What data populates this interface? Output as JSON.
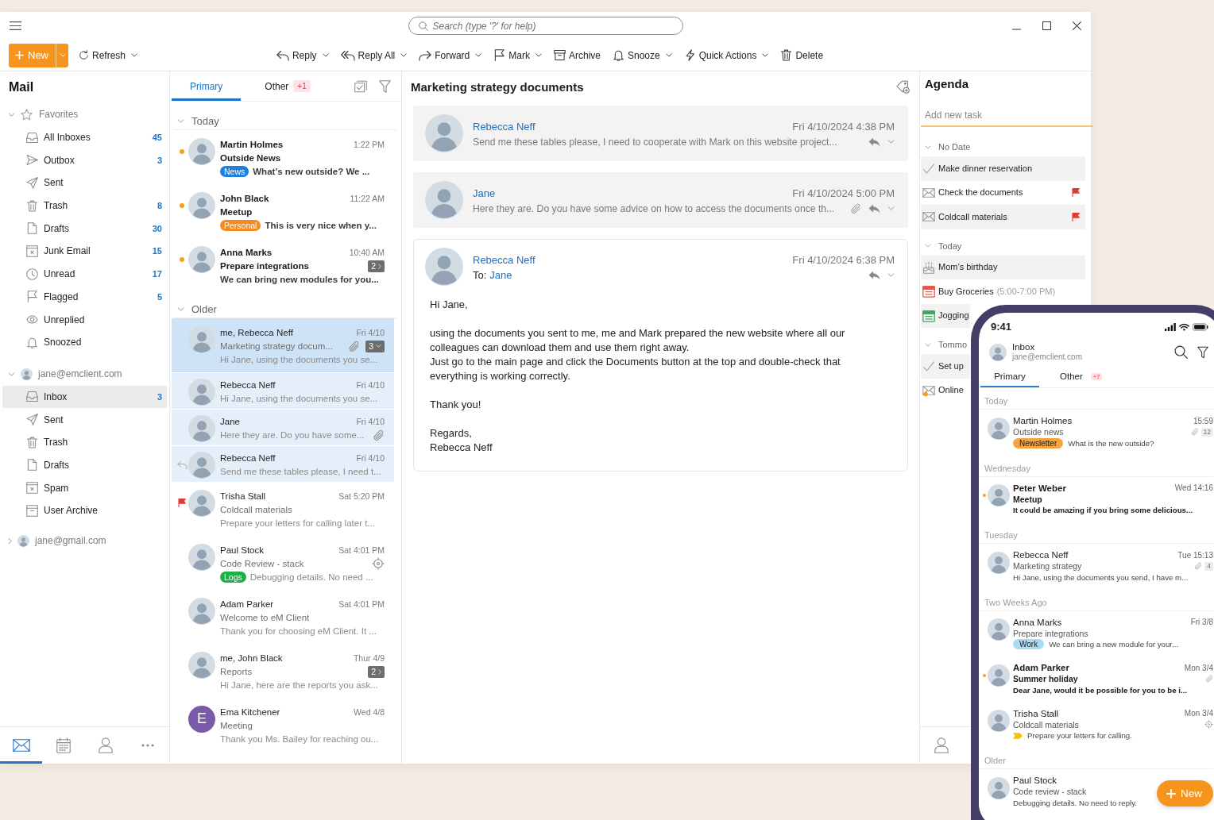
{
  "title_bar": {
    "search": {
      "placeholder": "Search (type '?' for help)"
    }
  },
  "toolbar": {
    "new_button": {
      "label": "New"
    },
    "refresh_button": {
      "label": "Refresh",
      "dropdown": true
    },
    "actions": [
      {
        "kind": "reply",
        "label": "Reply",
        "dropdown": true
      },
      {
        "kind": "replyall",
        "label": "Reply All",
        "dropdown": true
      },
      {
        "kind": "forward",
        "label": "Forward",
        "dropdown": true
      },
      {
        "kind": "mark",
        "label": "Mark",
        "dropdown": true
      },
      {
        "kind": "archive",
        "label": "Archive",
        "dropdown": false
      },
      {
        "kind": "snooze",
        "label": "Snooze",
        "dropdown": true
      },
      {
        "kind": "actions",
        "label": "Quick Actions",
        "dropdown": true
      },
      {
        "kind": "delete",
        "label": "Delete",
        "dropdown": false
      }
    ]
  },
  "sidebar": {
    "title": "Mail",
    "favorites": {
      "label": "Favorites",
      "expanded": true,
      "folders": [
        {
          "kind": "inbox",
          "label": "All Inboxes",
          "count": "45",
          "selected": false
        },
        {
          "kind": "outbox",
          "label": "Outbox",
          "count": "3",
          "selected": false
        },
        {
          "kind": "sent",
          "label": "Sent",
          "selected": false
        },
        {
          "kind": "trash",
          "label": "Trash",
          "count": "8",
          "selected": false
        },
        {
          "kind": "drafts",
          "label": "Drafts",
          "count": "30",
          "selected": false
        },
        {
          "kind": "junk",
          "label": "Junk Email",
          "count": "15",
          "selected": false
        },
        {
          "kind": "unread",
          "label": "Unread",
          "count": "17",
          "selected": false
        },
        {
          "kind": "flagged",
          "label": "Flagged",
          "count": "5",
          "selected": false
        },
        {
          "kind": "unreplied",
          "label": "Unreplied",
          "selected": false
        },
        {
          "kind": "snoozed",
          "label": "Snoozed",
          "selected": false
        }
      ]
    },
    "accounts": [
      {
        "label": "jane@emclient.com",
        "expanded": true,
        "folders": [
          {
            "kind": "inbox",
            "label": "Inbox",
            "count": "3",
            "selected": true
          },
          {
            "kind": "sent",
            "label": "Sent",
            "selected": false
          },
          {
            "kind": "trash",
            "label": "Trash",
            "selected": false
          },
          {
            "kind": "drafts",
            "label": "Drafts",
            "selected": false
          },
          {
            "kind": "junk",
            "label": "Spam",
            "selected": false
          },
          {
            "kind": "archive",
            "label": "User Archive",
            "selected": false
          }
        ]
      },
      {
        "label": "jane@gmail.com",
        "expanded": false
      }
    ],
    "bottom_nav": [
      {
        "kind": "mail",
        "selected": true
      },
      {
        "kind": "calendar",
        "selected": false
      },
      {
        "kind": "contacts",
        "selected": false
      },
      {
        "kind": "more",
        "selected": false
      }
    ]
  },
  "message_list": {
    "tabs": [
      {
        "label": "Primary",
        "selected": true
      },
      {
        "label": "Other",
        "badge": "+1",
        "selected": false
      }
    ],
    "groups": [
      {
        "label": "Today",
        "expanded": true,
        "messages": [
          {
            "sender": "Martin Holmes",
            "time": "1:22 PM",
            "subject": "Outside News",
            "preview": "What’s new outside? We ...",
            "tag": {
              "label": "News",
              "color": "#1f7fe0"
            },
            "unread": true,
            "selected": false
          },
          {
            "sender": "John Black",
            "time": "11:22 AM",
            "subject": "Meetup",
            "preview": "This is very nice when y...",
            "tag": {
              "label": "Personal",
              "color": "#f58a1f"
            },
            "unread": true,
            "selected": false
          },
          {
            "sender": "Anna Marks",
            "time": "10:40 AM",
            "subject": "Prepare integrations",
            "preview": "We can bring new modules for you...",
            "thread": {
              "count": "2",
              "expanded": false
            },
            "unread": true,
            "selected": false
          }
        ]
      },
      {
        "label": "Older",
        "expanded": true,
        "messages": [
          {
            "sender": "me, Rebecca Neff",
            "time": "Fri 4/10",
            "subject": "Marketing strategy docum...",
            "preview": "Hi Jane, using the documents you se...",
            "attachment": true,
            "thread": {
              "count": "3",
              "expanded": true
            },
            "unread": false,
            "selected": true,
            "children": [
              {
                "sender": "Rebecca Neff",
                "time": "Fri 4/10",
                "preview": "Hi Jane, using the documents you se...",
                "unread": false,
                "selected": false
              },
              {
                "sender": "Jane",
                "time": "Fri 4/10",
                "preview": "Here they are. Do you have some...",
                "attachment": true,
                "unread": false,
                "selected": false
              },
              {
                "sender": "Rebecca Neff",
                "time": "Fri 4/10",
                "preview": "Send me these tables please, I need t...",
                "replied": true,
                "unread": false,
                "selected": false
              }
            ]
          },
          {
            "sender": "Trisha Stall",
            "time": "Sat 5:20 PM",
            "subject": "Coldcall materials",
            "preview": "Prepare your letters for calling later t...",
            "flagged": true,
            "unread": false,
            "selected": false
          },
          {
            "sender": "Paul Stock",
            "time": "Sat 4:01 PM",
            "subject": "Code Review - stack",
            "preview": "Debugging details. No need ...",
            "tag": {
              "label": "Logs",
              "color": "#1db046"
            },
            "tracked": true,
            "unread": false,
            "selected": false
          },
          {
            "sender": "Adam Parker",
            "time": "Sat 4:01 PM",
            "subject": "Welcome to eM Client",
            "preview": "Thank you for choosing eM Client. It ...",
            "unread": false,
            "selected": false
          },
          {
            "sender": "me, John Black",
            "time": "Thur 4/9",
            "subject": "Reports",
            "preview": "Hi Jane, here are the reports you ask...",
            "thread": {
              "count": "2",
              "expanded": false
            },
            "unread": false,
            "selected": false
          },
          {
            "sender": "Ema Kitchener",
            "initial": "E",
            "time": "Wed 4/8",
            "subject": "Meeting",
            "preview": "Thank you Ms. Bailey for reaching ou...",
            "unread": false,
            "selected": false
          }
        ]
      }
    ]
  },
  "reading_pane": {
    "subject": "Marketing strategy documents",
    "messages": [
      {
        "sender": "Rebecca Neff",
        "date": "Fri 4/10/2024 4:38 PM",
        "preview": "Send me these tables please, I need to cooperate with Mark on this website project...",
        "expanded": false
      },
      {
        "sender": "Jane",
        "date": "Fri 4/10/2024 5:00 PM",
        "preview": "Here they are. Do you have some advice on how to access the documents once th...",
        "attachment": true,
        "expanded": false
      },
      {
        "sender": "Rebecca Neff",
        "date": "Fri 4/10/2024 6:38 PM",
        "to_label": "To:",
        "to": "Jane",
        "expanded": true,
        "body": [
          [
            "Hi Jane,"
          ],
          [
            "using the documents you sent to me, me and Mark prepared the new website where all our colleagues can download them and use them right away.",
            "Just go to the main page and click the Documents button at the top and double-check that everything is working correctly."
          ],
          [
            "Thank you!"
          ],
          [
            "Regards,",
            "Rebecca Neff"
          ]
        ]
      }
    ]
  },
  "agenda": {
    "title": "Agenda",
    "new_task": {
      "placeholder": "Add new task"
    },
    "groups": [
      {
        "label": "No Date",
        "expanded": true,
        "items": [
          {
            "kind": "task",
            "title": "Make dinner reservation"
          },
          {
            "kind": "mail",
            "title": "Check the documents",
            "flagged": true,
            "unread": false
          },
          {
            "kind": "mail",
            "title": "Coldcall materials",
            "flagged": true,
            "unread": false
          }
        ]
      },
      {
        "label": "Today",
        "expanded": true,
        "items": [
          {
            "kind": "birthday",
            "title": "Mom’s birthday"
          },
          {
            "kind": "event",
            "title": "Buy Groceries",
            "time": "(5:00-7:00 PM)",
            "color": "#e8554e"
          },
          {
            "kind": "event",
            "title": "Jogging",
            "color": "#3fa85a"
          }
        ]
      },
      {
        "label": "Tommo",
        "expanded": true,
        "items": [
          {
            "kind": "task",
            "title": "Set up"
          },
          {
            "kind": "mail",
            "title": "Online",
            "unread": true
          }
        ]
      }
    ]
  },
  "phone": {
    "status_time": "9:41",
    "mailbox": {
      "title": "Inbox",
      "account": "jane@emclient.com"
    },
    "tabs": [
      {
        "label": "Primary",
        "selected": true
      },
      {
        "label": "Other",
        "badge": "+7",
        "selected": false
      }
    ],
    "sections": [
      {
        "label": "Today",
        "messages": [
          {
            "sender": "Martin Holmes",
            "time": "15:59",
            "subject": "Outside news",
            "preview": "What is the new outside?",
            "attachment": true,
            "count": "12",
            "tag": {
              "label": "Newsletter",
              "color": "#f8a33c"
            },
            "unread": false,
            "selected": false
          }
        ]
      },
      {
        "label": "Wednesday",
        "messages": [
          {
            "sender": "Peter Weber",
            "time": "Wed 14:16",
            "subject": "Meetup",
            "preview": "It could be amazing if you bring some delicious...",
            "unread": true,
            "selected": false
          }
        ]
      },
      {
        "label": "Tuesday",
        "messages": [
          {
            "sender": "Rebecca Neff",
            "time": "Tue 15:13",
            "subject": "Marketing strategy",
            "preview": "Hi Jane, using the documents you send, I have m...",
            "attachment": true,
            "count": "4",
            "unread": false,
            "selected": false
          }
        ]
      },
      {
        "label": "Two Weeks Ago",
        "messages": [
          {
            "sender": "Anna Marks",
            "time": "Fri 3/8",
            "subject": "Prepare integrations",
            "preview": "We can bring a new module for your...",
            "tag": {
              "label": "Work",
              "color": "#a9dbf7"
            },
            "unread": false,
            "selected": false
          },
          {
            "sender": "Adam Parker",
            "time": "Mon 3/4",
            "subject": "Summer holiday",
            "preview": "Dear Jane, would it be possible for you to be i...",
            "attachment": true,
            "unread": true,
            "selected": false
          },
          {
            "sender": "Trisha Stall",
            "time": "Mon 3/4",
            "subject": "Coldcall materials",
            "preview": "Prepare your letters for calling.",
            "tracked": true,
            "tag": {
              "color": "#f4c20d"
            },
            "unread": false,
            "selected": false
          }
        ]
      },
      {
        "label": "Older",
        "messages": [
          {
            "sender": "Paul Stock",
            "subject": "Code review - stack",
            "preview": "Debugging details. No need to reply.",
            "unread": false,
            "selected": false
          }
        ]
      }
    ],
    "new_button": {
      "label": "New"
    }
  }
}
